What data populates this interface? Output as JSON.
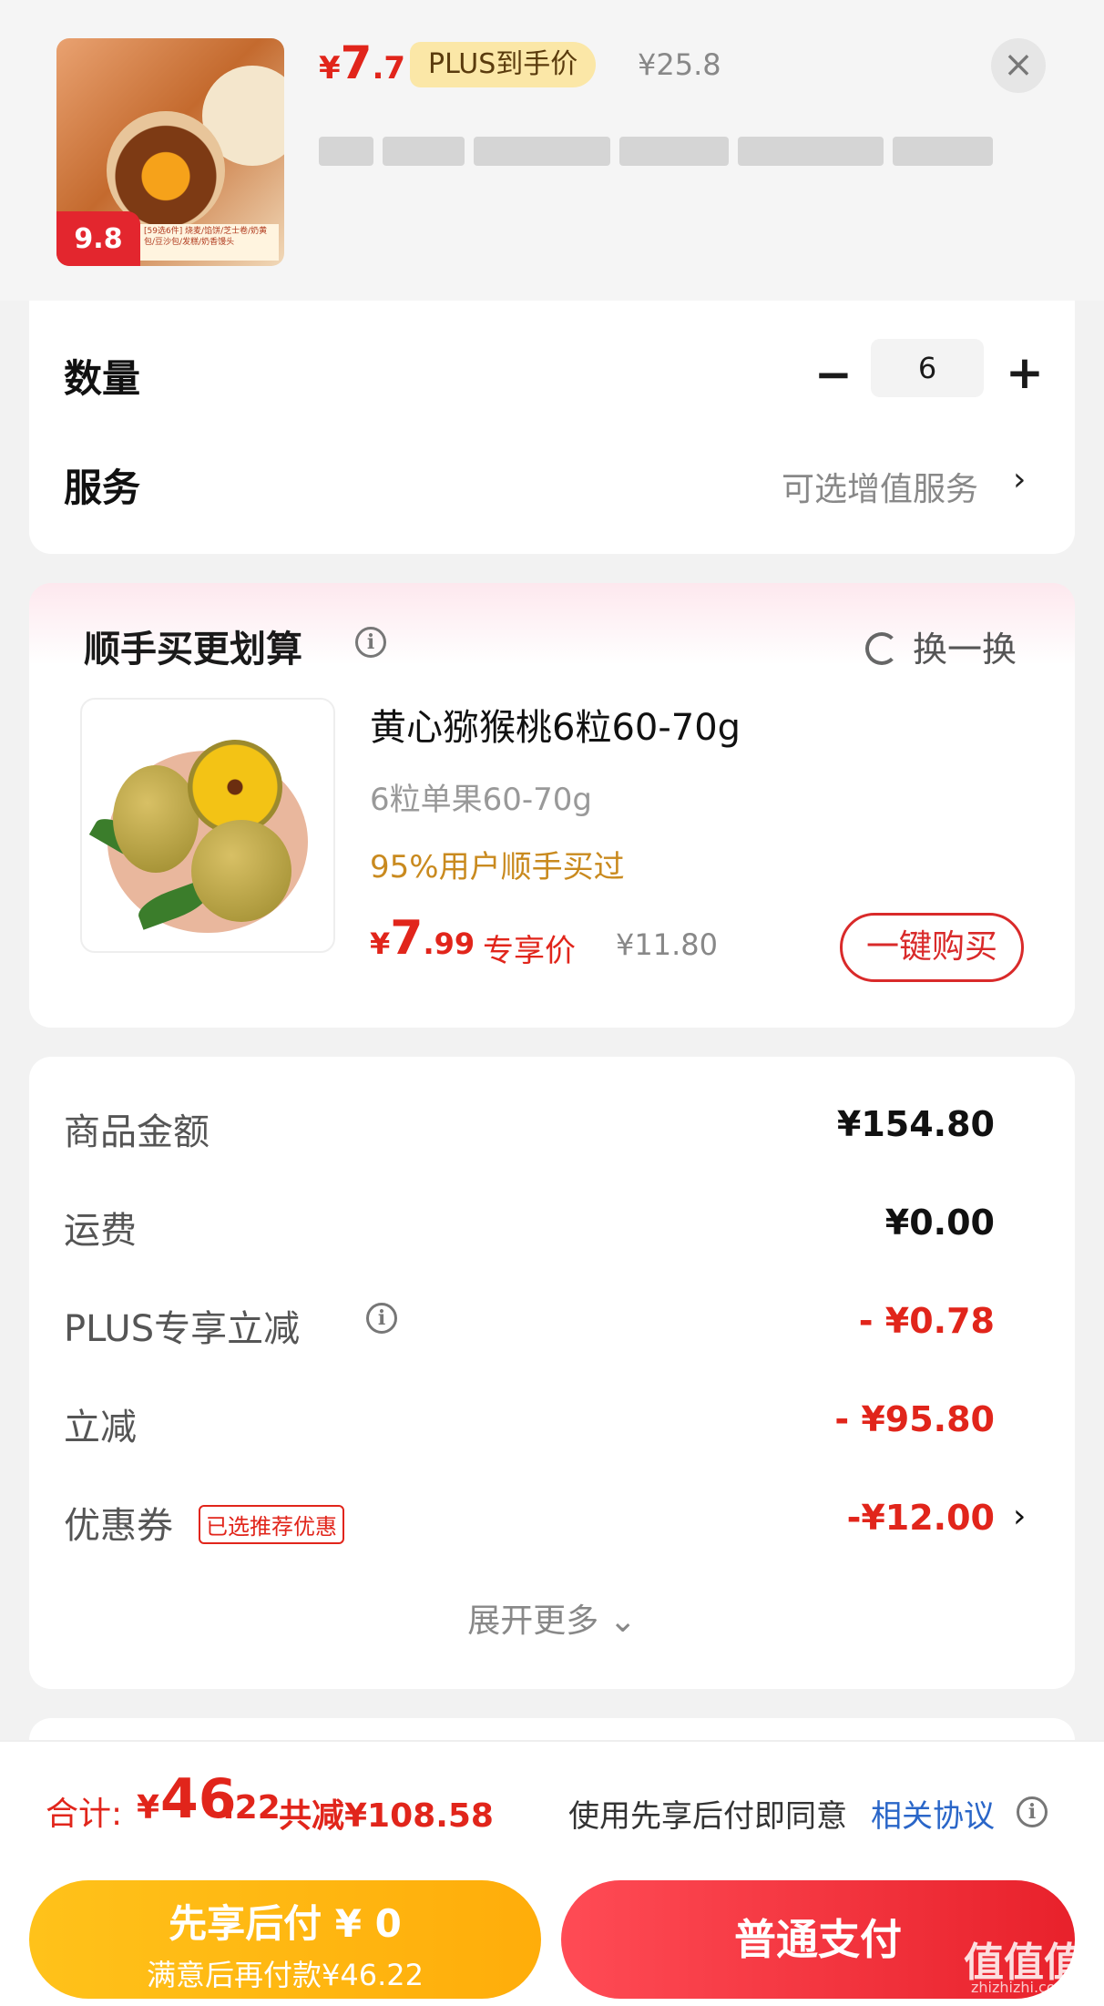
{
  "header": {
    "thumb_badge": "9.8",
    "thumb_strip_text": "[59选6件] 烧麦/馅饼/芝士卷/奶黄包/豆沙包/发糕/奶香馒头",
    "price_yen": "¥",
    "price_big": "7",
    "price_small": ".7",
    "plus_tag": "PLUS到手价",
    "orig_price": "¥25.8",
    "close_icon": "×"
  },
  "quantity": {
    "label": "数量",
    "minus": "−",
    "value": "6",
    "plus": "+"
  },
  "service": {
    "label": "服务",
    "text": "可选增值服务",
    "chevron": "›"
  },
  "upsell": {
    "title": "顺手买更划算",
    "info": "i",
    "refresh_label": "换一换",
    "product": {
      "title": "黄心猕猴桃6粒60-70g",
      "spec": "6粒单果60-70g",
      "social": "95%用户顺手买过",
      "price_yen": "¥",
      "price_big": "7",
      "price_small": ".99",
      "exclusive": "专享价",
      "orig_price": "¥11.80",
      "buy_label": "一键购买"
    }
  },
  "summary": {
    "rows": [
      {
        "label": "商品金额",
        "value": "¥154.80"
      },
      {
        "label": "运费",
        "value": "¥0.00"
      },
      {
        "label": "PLUS专享立减",
        "value": "- ¥0.78"
      },
      {
        "label": "立减",
        "value": "- ¥95.80"
      },
      {
        "label": "优惠券",
        "tag": "已选推荐优惠",
        "value": "-¥12.00"
      }
    ],
    "expand_label": "展开更多 ⌄"
  },
  "bottom": {
    "total_label": "合计:",
    "total_yen": "¥",
    "total_big": "46",
    "total_small": ".22",
    "saved": "共减¥108.58",
    "agree_text": "使用先享后付即同意",
    "agree_link": "相关协议",
    "btn_later_l1": "先享后付 ¥ 0",
    "btn_later_l2": "满意后再付款¥46.22",
    "btn_pay": "普通支付",
    "watermark": "值值值",
    "watermark_sub": "zhizhizhi.com"
  },
  "colors": {
    "accent": "#e1251b",
    "link": "#2a66c8",
    "gold": "#ffc21a"
  },
  "icons": [
    "close-icon",
    "info-icon",
    "refresh-icon",
    "chevron-right-icon",
    "chevron-down-icon"
  ]
}
